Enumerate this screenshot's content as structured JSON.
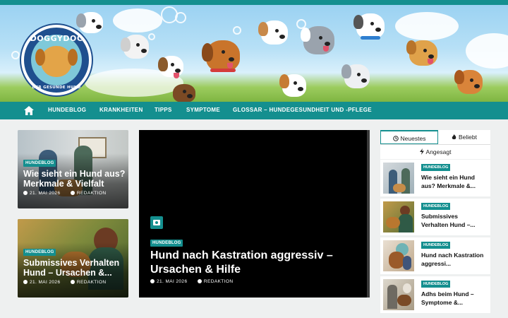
{
  "brand": {
    "name": "DOGGYDOC",
    "tagline": "DER GESUNDE HUND"
  },
  "nav": {
    "home_icon": "home-icon",
    "items": [
      {
        "label": "HUNDEBLOG"
      },
      {
        "label": "KRANKHEITEN"
      },
      {
        "label": "TIPPS"
      },
      {
        "label": "SYMPTOME"
      },
      {
        "label": "GLOSSAR – HUNDEGESUNDHEIT UND -PFLEGE"
      }
    ]
  },
  "featured_left": [
    {
      "badge": "HUNDEBLOG",
      "title": "Wie sieht ein Hund aus? Merkmale & Vielfalt",
      "date": "21. MAI 2026",
      "author": "REDAKTION"
    },
    {
      "badge": "HUNDEBLOG",
      "title": "Submissives Verhalten Hund – Ursachen &...",
      "date": "21. MAI 2026",
      "author": "REDAKTION"
    }
  ],
  "featured_main": {
    "badge": "HUNDEBLOG",
    "title": "Hund nach Kastration aggressiv – Ursachen & Hilfe",
    "date": "21. MAI 2026",
    "author": "REDAKTION",
    "media_icon": "camera-icon"
  },
  "sidebar": {
    "tabs": [
      {
        "label": "Neuestes",
        "icon": "clock-icon",
        "active": true
      },
      {
        "label": "Beliebt",
        "icon": "fire-icon",
        "active": false
      },
      {
        "label": "Angesagt",
        "icon": "bolt-icon",
        "active": false
      }
    ],
    "items": [
      {
        "badge": "HUNDEBLOG",
        "title": "Wie sieht ein Hund aus? Merkmale &..."
      },
      {
        "badge": "HUNDEBLOG",
        "title": "Submissives Verhalten Hund –..."
      },
      {
        "badge": "HUNDEBLOG",
        "title": "Hund nach Kastration aggressi..."
      },
      {
        "badge": "HUNDEBLOG",
        "title": "Adhs beim Hund – Symptome &..."
      }
    ]
  },
  "colors": {
    "accent": "#148f8f",
    "logo_blue": "#1f4f8e",
    "page_bg": "#eef0f0"
  }
}
